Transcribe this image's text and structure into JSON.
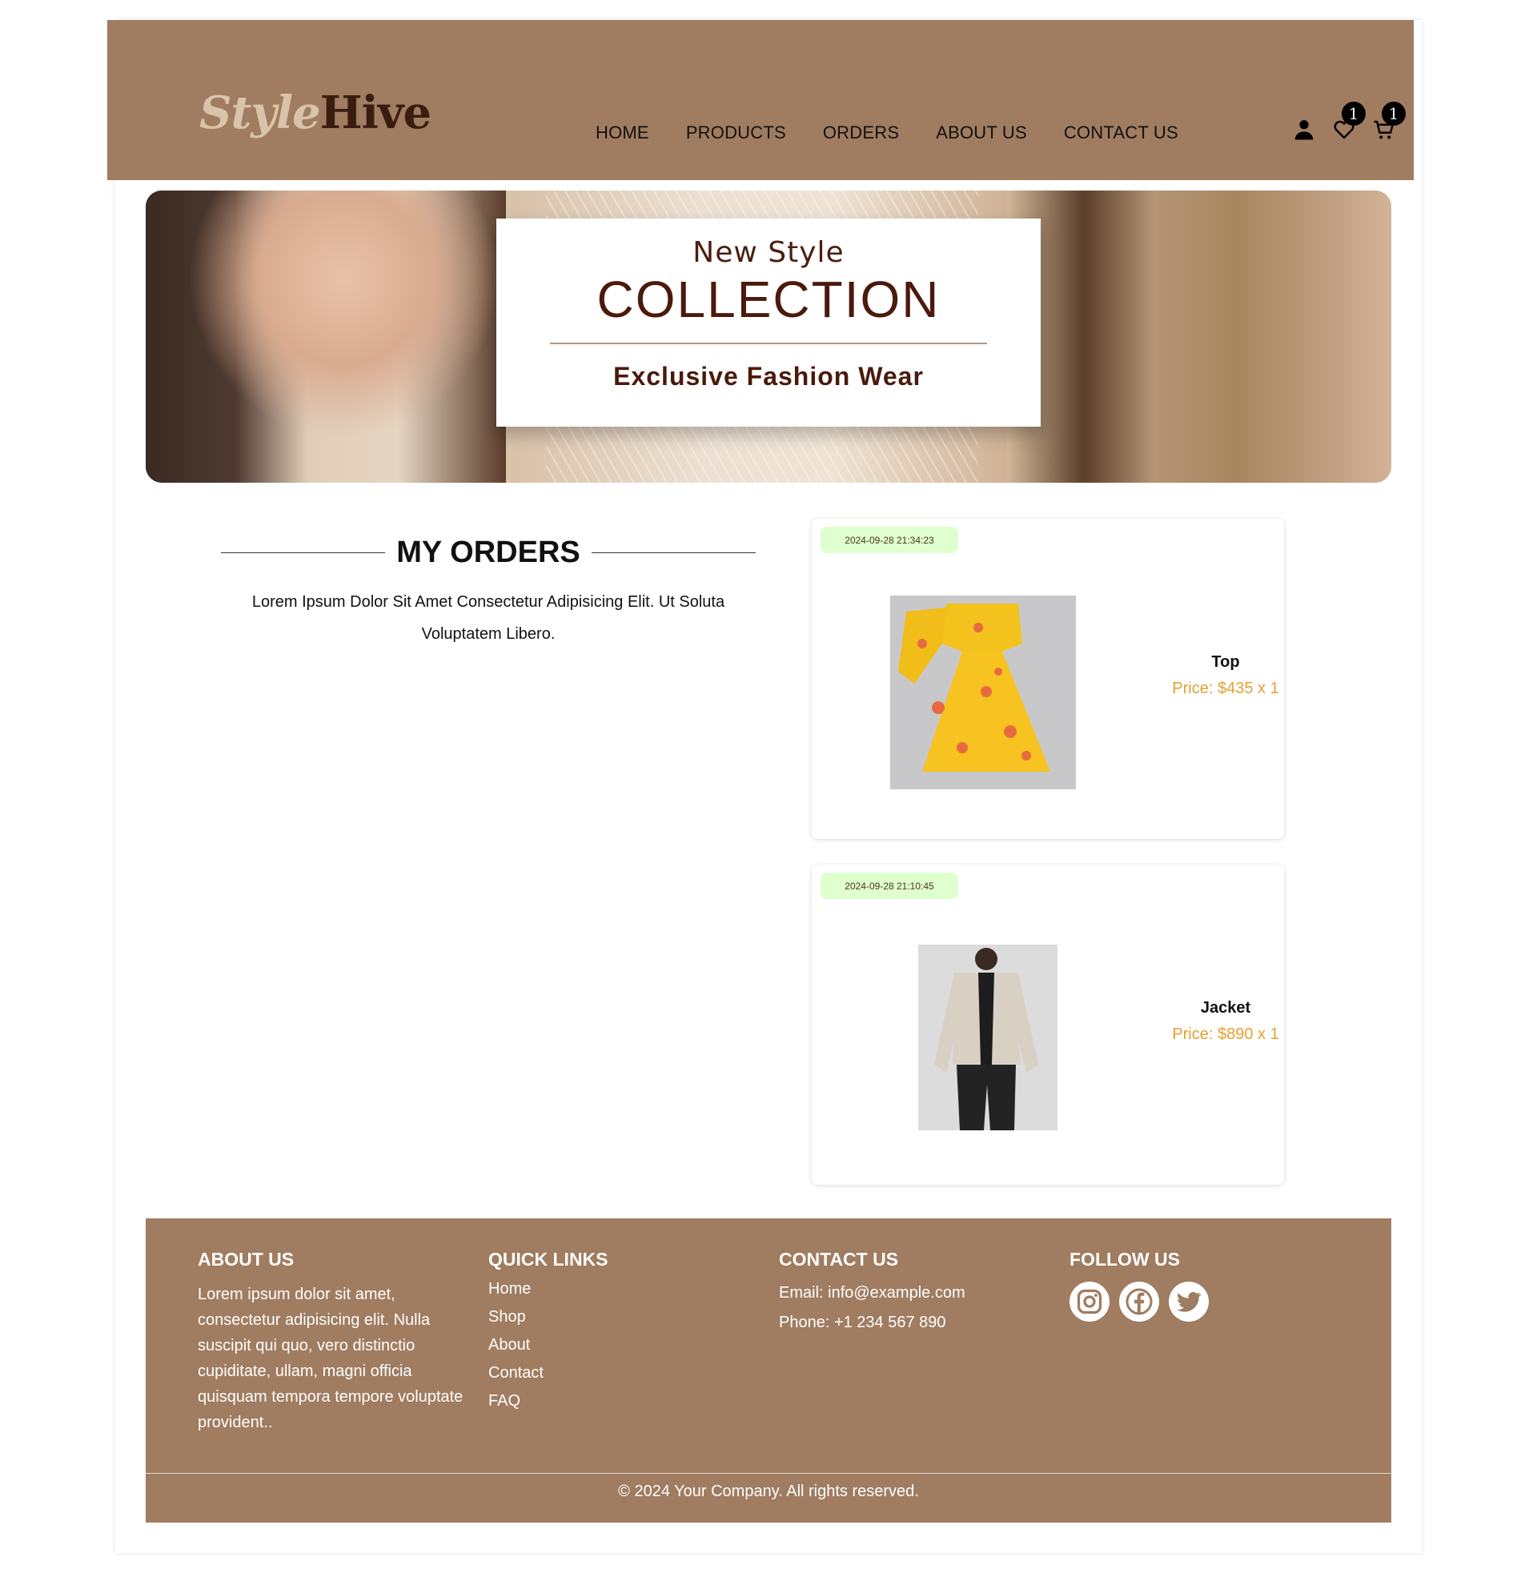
{
  "brand": {
    "logo_part1": "Style",
    "logo_part2": "Hive"
  },
  "nav": [
    "HOME",
    "PRODUCTS",
    "ORDERS",
    "ABOUT US",
    "CONTACT US"
  ],
  "header_icons": {
    "wishlist_count": "1",
    "cart_count": "1",
    "user_icon": "user-icon",
    "wishlist_icon": "heart-icon",
    "cart_icon": "cart-icon"
  },
  "banner": {
    "kicker": "New Style",
    "headline": "COLLECTION",
    "sub": "Exclusive Fashion Wear"
  },
  "orders_section": {
    "title": "MY ORDERS",
    "description": "Lorem Ipsum Dolor Sit Amet Consectetur Adipisicing Elit. Ut Soluta Voluptatem Libero."
  },
  "orders": [
    {
      "date": "2024-09-28 21:34:23",
      "name": "Top",
      "price": "Price: $435 x 1"
    },
    {
      "date": "2024-09-28 21:10:45",
      "name": "Jacket",
      "price": "Price: $890 x 1"
    }
  ],
  "footer": {
    "about_title": "ABOUT US",
    "about_text": "Lorem ipsum dolor sit amet, consectetur adipisicing elit. Nulla suscipit qui quo, vero distinctio cupiditate, ullam, magni officia quisquam tempora tempore voluptate provident..",
    "links_title": "QUICK LINKS",
    "links": [
      "Home",
      "Shop",
      "About",
      "Contact",
      "FAQ"
    ],
    "contact_title": "CONTACT US",
    "email": "Email: info@example.com",
    "phone": "Phone: +1 234 567 890",
    "follow_title": "FOLLOW US",
    "social_icons": [
      "instagram-icon",
      "facebook-icon",
      "twitter-icon"
    ],
    "copyright": "© 2024 Your Company. All rights reserved."
  },
  "colors": {
    "brand_brown": "#a07c60",
    "dark_brown": "#4a1a0c",
    "price_orange": "#e6a030",
    "date_badge": "#dfffcf"
  }
}
